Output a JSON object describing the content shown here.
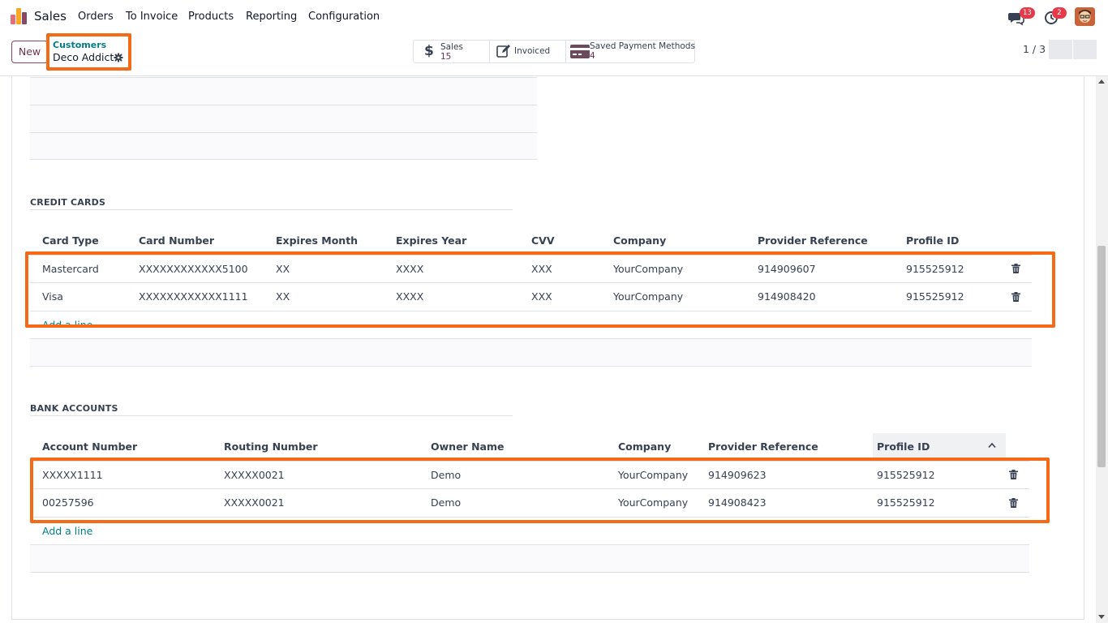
{
  "navbar": {
    "app_name": "Sales",
    "menu": [
      "Orders",
      "To Invoice",
      "Products",
      "Reporting",
      "Configuration"
    ],
    "messages_count": "13",
    "activities_count": "2"
  },
  "control_panel": {
    "new_label": "New",
    "breadcrumb_parent": "Customers",
    "breadcrumb_current": "Deco Addict",
    "stats": [
      {
        "label": "Sales",
        "value": "15"
      },
      {
        "label": "Invoiced",
        "value": ""
      },
      {
        "label": "Saved Payment Methods",
        "value": "4"
      }
    ],
    "pager": "1 / 3"
  },
  "credit_cards": {
    "title": "CREDIT CARDS",
    "columns": [
      "Card Type",
      "Card Number",
      "Expires Month",
      "Expires Year",
      "CVV",
      "Company",
      "Provider Reference",
      "Profile ID"
    ],
    "rows": [
      [
        "Mastercard",
        "XXXXXXXXXXXX5100",
        "XX",
        "XXXX",
        "XXX",
        "YourCompany",
        "914909607",
        "915525912"
      ],
      [
        "Visa",
        "XXXXXXXXXXXX1111",
        "XX",
        "XXXX",
        "XXX",
        "YourCompany",
        "914908420",
        "915525912"
      ]
    ],
    "add_line": "Add a line"
  },
  "bank_accounts": {
    "title": "BANK ACCOUNTS",
    "columns": [
      "Account Number",
      "Routing Number",
      "Owner Name",
      "Company",
      "Provider Reference",
      "Profile ID"
    ],
    "rows": [
      [
        "XXXXX1111",
        "XXXXX0021",
        "Demo",
        "YourCompany",
        "914909623",
        "915525912"
      ],
      [
        "00257596",
        "XXXXX0021",
        "Demo",
        "YourCompany",
        "914908423",
        "915525912"
      ]
    ],
    "add_line": "Add a line"
  },
  "colors": {
    "brand": "#71344f",
    "link": "#017e84",
    "highlight": "#f46a16",
    "badge": "#e8394a"
  }
}
